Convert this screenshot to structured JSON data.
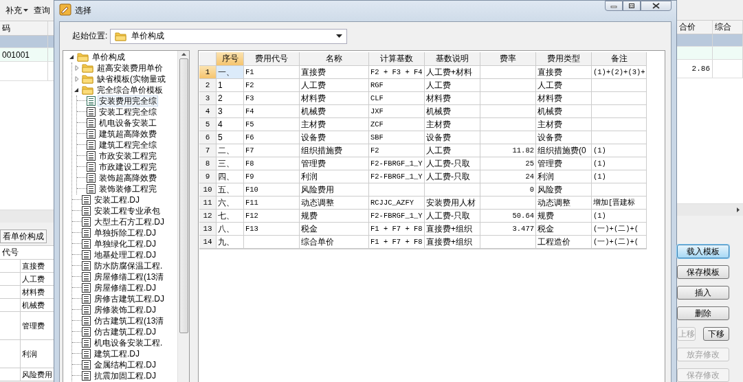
{
  "background": {
    "toolbar": [
      {
        "label": "补充",
        "dropdown": true
      },
      {
        "label": "查询",
        "dropdown": false
      }
    ],
    "top_grid": {
      "left_header": "码",
      "right_headers": [
        "合价",
        "综合"
      ],
      "rows": [
        {
          "kind": "focus",
          "code": "",
          "total": ""
        },
        {
          "kind": "group",
          "code": "001001",
          "total": ""
        },
        {
          "kind": "item",
          "code": "",
          "total": "2.86"
        }
      ]
    },
    "bottom_tab": "看单价构成",
    "bottom_grid": {
      "header": "代号",
      "rows": [
        {
          "kind": "normal",
          "name": "直接费"
        },
        {
          "kind": "normal",
          "name": "人工费"
        },
        {
          "kind": "normal",
          "name": "材料费"
        },
        {
          "kind": "normal",
          "name": "机械费"
        },
        {
          "kind": "tall",
          "name": "管理费"
        },
        {
          "kind": "tall",
          "name": "利润"
        },
        {
          "kind": "normal",
          "name": "风险费用"
        }
      ]
    },
    "buttons": [
      {
        "label": "载入模板",
        "kind": "full",
        "focused": true,
        "disabled": false
      },
      {
        "label": "保存模板",
        "kind": "full",
        "focused": false,
        "disabled": false
      },
      {
        "label": "插入",
        "kind": "full",
        "focused": false,
        "disabled": false
      },
      {
        "label": "删除",
        "kind": "full",
        "focused": false,
        "disabled": false
      },
      {
        "label": "上移",
        "kind": "left",
        "focused": false,
        "disabled": true
      },
      {
        "label": "下移",
        "kind": "right",
        "focused": false,
        "disabled": false
      },
      {
        "label": "放弃修改",
        "kind": "full",
        "focused": false,
        "disabled": true
      },
      {
        "label": "保存修改",
        "kind": "full",
        "focused": false,
        "disabled": true
      }
    ]
  },
  "dialog": {
    "title": "选择",
    "start_location": {
      "label": "起始位置:",
      "value": "单价构成"
    },
    "tree": [
      {
        "label": "单价构成",
        "kind": "folder",
        "expanded": true,
        "selected": false,
        "children": [
          {
            "label": "超高安装费用单价",
            "kind": "folder",
            "expanded": false,
            "selected": false
          },
          {
            "label": "缺省模板(实物量或",
            "kind": "folder",
            "expanded": false,
            "selected": false
          },
          {
            "label": "完全综合单价模板",
            "kind": "folder",
            "expanded": true,
            "selected": false,
            "children": [
              {
                "label": "安装费用完全综",
                "kind": "file",
                "selected": true
              },
              {
                "label": "安装工程完全综",
                "kind": "file",
                "selected": false
              },
              {
                "label": "机电设备安装工",
                "kind": "file",
                "selected": false
              },
              {
                "label": "建筑超高降效费",
                "kind": "file",
                "selected": false
              },
              {
                "label": "建筑工程完全综",
                "kind": "file",
                "selected": false
              },
              {
                "label": "市政安装工程完",
                "kind": "file",
                "selected": false
              },
              {
                "label": "市政建设工程完",
                "kind": "file",
                "selected": false
              },
              {
                "label": "装饰超高降效费",
                "kind": "file",
                "selected": false
              },
              {
                "label": "装饰装修工程完",
                "kind": "file",
                "selected": false
              }
            ]
          },
          {
            "label": "安装工程.DJ",
            "kind": "file",
            "selected": false
          },
          {
            "label": "安装工程专业承包",
            "kind": "file",
            "selected": false
          },
          {
            "label": "大型土石方工程.DJ",
            "kind": "file",
            "selected": false
          },
          {
            "label": "单独拆除工程.DJ",
            "kind": "file",
            "selected": false
          },
          {
            "label": "单独绿化工程.DJ",
            "kind": "file",
            "selected": false
          },
          {
            "label": "地基处理工程.DJ",
            "kind": "file",
            "selected": false
          },
          {
            "label": "防水防腐保温工程.",
            "kind": "file",
            "selected": false
          },
          {
            "label": "房屋修缮工程(13清",
            "kind": "file",
            "selected": false
          },
          {
            "label": "房屋修缮工程.DJ",
            "kind": "file",
            "selected": false
          },
          {
            "label": "房修古建筑工程.DJ",
            "kind": "file",
            "selected": false
          },
          {
            "label": "房修装饰工程.DJ",
            "kind": "file",
            "selected": false
          },
          {
            "label": "仿古建筑工程(13清",
            "kind": "file",
            "selected": false
          },
          {
            "label": "仿古建筑工程.DJ",
            "kind": "file",
            "selected": false
          },
          {
            "label": "机电设备安装工程.",
            "kind": "file",
            "selected": false
          },
          {
            "label": "建筑工程.DJ",
            "kind": "file",
            "selected": false
          },
          {
            "label": "金属结构工程.DJ",
            "kind": "file",
            "selected": false
          },
          {
            "label": "抗震加固工程.DJ",
            "kind": "file",
            "selected": false
          }
        ]
      }
    ],
    "table": {
      "columns": [
        {
          "label": "序号",
          "selected": true
        },
        {
          "label": "费用代号",
          "selected": false
        },
        {
          "label": "名称",
          "selected": false
        },
        {
          "label": "计算基数",
          "selected": false
        },
        {
          "label": "基数说明",
          "selected": false
        },
        {
          "label": "费率",
          "selected": false
        },
        {
          "label": "费用类型",
          "selected": false
        },
        {
          "label": "备注",
          "selected": false
        }
      ],
      "rows": [
        {
          "number": "1",
          "selected": true,
          "cells": [
            "一、",
            "F1",
            "直接费",
            "F2 + F3 + F4",
            "人工费+材料",
            "",
            "直接费",
            "(1)+(2)+(3)+"
          ]
        },
        {
          "number": "2",
          "selected": false,
          "cells": [
            "1",
            "F2",
            "人工费",
            "RGF",
            "人工费",
            "",
            "人工费",
            ""
          ]
        },
        {
          "number": "3",
          "selected": false,
          "cells": [
            "2",
            "F3",
            "材料费",
            "CLF",
            "材料费",
            "",
            "材料费",
            ""
          ]
        },
        {
          "number": "4",
          "selected": false,
          "cells": [
            "3",
            "F4",
            "机械费",
            "JXF",
            "机械费",
            "",
            "机械费",
            ""
          ]
        },
        {
          "number": "5",
          "selected": false,
          "cells": [
            "4",
            "F5",
            "主材费",
            "ZCF",
            "主材费",
            "",
            "主材费",
            ""
          ]
        },
        {
          "number": "6",
          "selected": false,
          "cells": [
            "5",
            "F6",
            "设备费",
            "SBF",
            "设备费",
            "",
            "设备费",
            ""
          ]
        },
        {
          "number": "7",
          "selected": false,
          "cells": [
            "二、",
            "F7",
            "组织措施费",
            "F2",
            "人工费",
            "11.82",
            "组织措施费(0",
            "(1)"
          ]
        },
        {
          "number": "8",
          "selected": false,
          "cells": [
            "三、",
            "F8",
            "管理费",
            "F2-FBRGF_1_Y",
            "人工费-只取",
            "25",
            "管理费",
            "(1)"
          ]
        },
        {
          "number": "9",
          "selected": false,
          "cells": [
            "四、",
            "F9",
            "利润",
            "F2-FBRGF_1_Y",
            "人工费-只取",
            "24",
            "利润",
            "(1)"
          ]
        },
        {
          "number": "10",
          "selected": false,
          "cells": [
            "五、",
            "F10",
            "风险费用",
            "",
            "",
            "0",
            "风险费",
            ""
          ]
        },
        {
          "number": "11",
          "selected": false,
          "cells": [
            "六、",
            "F11",
            "动态调整",
            "RCJJC_AZFY",
            "安装费用人材",
            "",
            "动态调整",
            "增加[晋建标"
          ]
        },
        {
          "number": "12",
          "selected": false,
          "cells": [
            "七、",
            "F12",
            "规费",
            "F2-FBRGF_1_Y",
            "人工费-只取",
            "50.64",
            "规费",
            "(1)"
          ]
        },
        {
          "number": "13",
          "selected": false,
          "cells": [
            "八、",
            "F13",
            "税金",
            "F1 + F7 + F8",
            "直接费+组织",
            "3.477",
            "税金",
            "(一)+(二)+("
          ]
        },
        {
          "number": "14",
          "selected": false,
          "cells": [
            "九、",
            "",
            "综合单价",
            "F1 + F7 + F8",
            "直接费+组织",
            "",
            "工程造价",
            "(一)+(二)+("
          ]
        }
      ]
    }
  }
}
